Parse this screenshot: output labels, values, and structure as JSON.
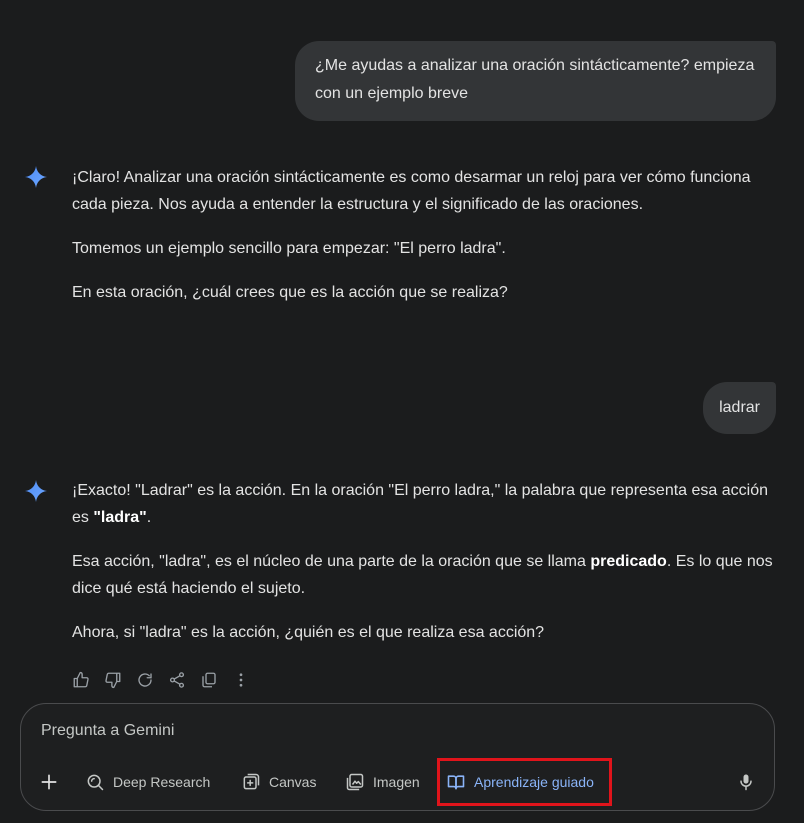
{
  "conversation": {
    "user_message_1": "¿Me ayudas a analizar una oración sintácticamente? empieza con un ejemplo breve",
    "ai_message_1": {
      "p1": "¡Claro! Analizar una oración sintácticamente es como desarmar un reloj para ver cómo funciona cada pieza. Nos ayuda a entender la estructura y el significado de las oraciones.",
      "p2": "Tomemos un ejemplo sencillo para empezar: \"El perro ladra\".",
      "p3": "En esta oración, ¿cuál crees que es la acción que se realiza?"
    },
    "user_message_2": "ladrar",
    "ai_message_2": {
      "p1_before": "¡Exacto! \"Ladrar\" es la acción. En la oración \"El perro ladra,\" la palabra que representa esa acción es ",
      "p1_bold": "\"ladra\"",
      "p1_after": ".",
      "p2_before": "Esa acción, \"ladra\", es el núcleo de una parte de la oración que se llama ",
      "p2_bold": "predicado",
      "p2_after": ". Es lo que nos dice qué está haciendo el sujeto.",
      "p3": "Ahora, si \"ladra\" es la acción, ¿quién es el que realiza esa acción?"
    }
  },
  "composer": {
    "placeholder": "Pregunta a Gemini",
    "tools": {
      "deep_research": "Deep Research",
      "canvas": "Canvas",
      "imagen": "Imagen",
      "guided_learning": "Aprendizaje guiado"
    }
  },
  "icons": {
    "assistant": "gemini-spark-icon",
    "actions": [
      "thumbs-up-icon",
      "thumbs-down-icon",
      "regenerate-icon",
      "share-icon",
      "copy-icon",
      "more-vert-icon"
    ],
    "composer": [
      "plus-icon",
      "deep-research-icon",
      "canvas-icon",
      "image-icon",
      "book-icon",
      "mic-icon"
    ]
  },
  "colors": {
    "background": "#1b1c1d",
    "user_bubble": "#333537",
    "accent_blue": "#8ab4f8",
    "highlight_red": "#e0141b"
  }
}
